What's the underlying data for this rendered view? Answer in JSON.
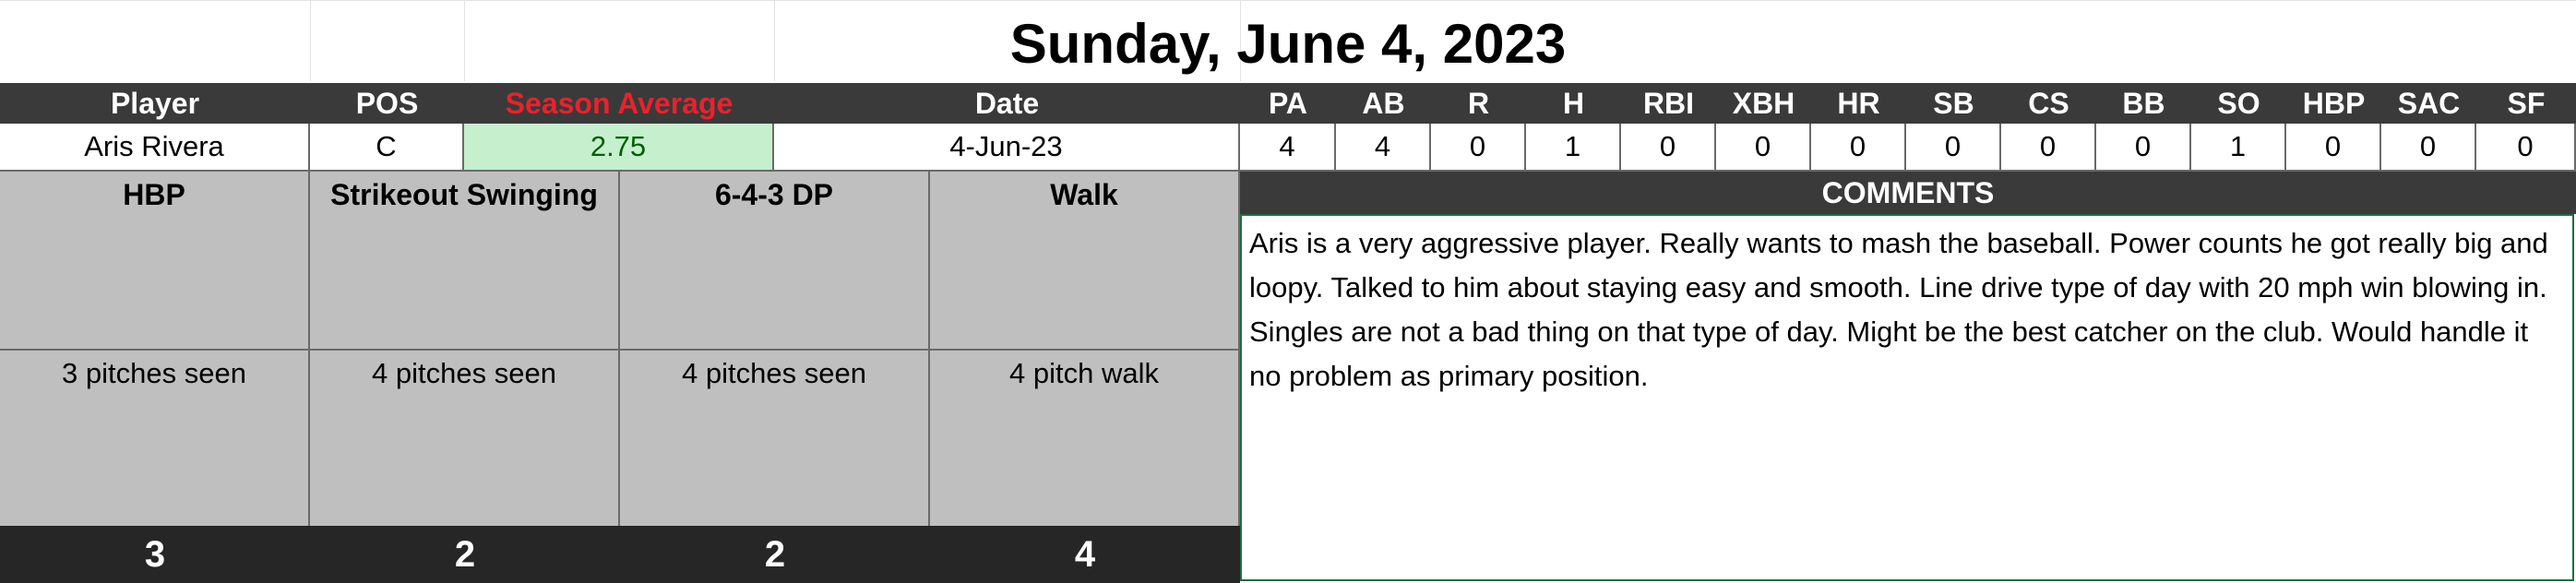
{
  "title": "Sunday, June 4, 2023",
  "headers": {
    "player": "Player",
    "pos": "POS",
    "season_avg": "Season Average",
    "date": "Date",
    "stats": [
      "PA",
      "AB",
      "R",
      "H",
      "RBI",
      "XBH",
      "HR",
      "SB",
      "CS",
      "BB",
      "SO",
      "HBP",
      "SAC",
      "SF"
    ]
  },
  "row": {
    "player": "Aris Rivera",
    "pos": "C",
    "season_avg": "2.75",
    "date": "4-Jun-23",
    "stats": [
      "4",
      "4",
      "0",
      "1",
      "0",
      "0",
      "0",
      "0",
      "0",
      "0",
      "1",
      "0",
      "0",
      "0"
    ]
  },
  "at_bats": [
    {
      "result": "HBP",
      "pitches": "3 pitches seen",
      "score": "3"
    },
    {
      "result": "Strikeout Swinging",
      "pitches": "4 pitches seen",
      "score": "2"
    },
    {
      "result": "6-4-3 DP",
      "pitches": "4 pitches seen",
      "score": "2"
    },
    {
      "result": "Walk",
      "pitches": "4 pitch walk",
      "score": "4"
    }
  ],
  "comments": {
    "header": "COMMENTS",
    "text": "Aris is a very aggressive player. Really wants to mash the baseball. Power counts he got really big and loopy. Talked to him about staying easy and smooth. Line drive type of day with 20 mph win blowing in. Singles are not a bad thing on that type of day. Might be the best catcher on the club. Would handle it no problem as primary position."
  },
  "colors": {
    "header_bg": "#3a3a3a",
    "season_avg_header": "#e8222d",
    "season_avg_fill": "#c6efce",
    "season_avg_text": "#006100",
    "at_bat_bg": "#bfbfbf",
    "totals_bg": "#262626",
    "comments_border": "#1f6e3f"
  }
}
